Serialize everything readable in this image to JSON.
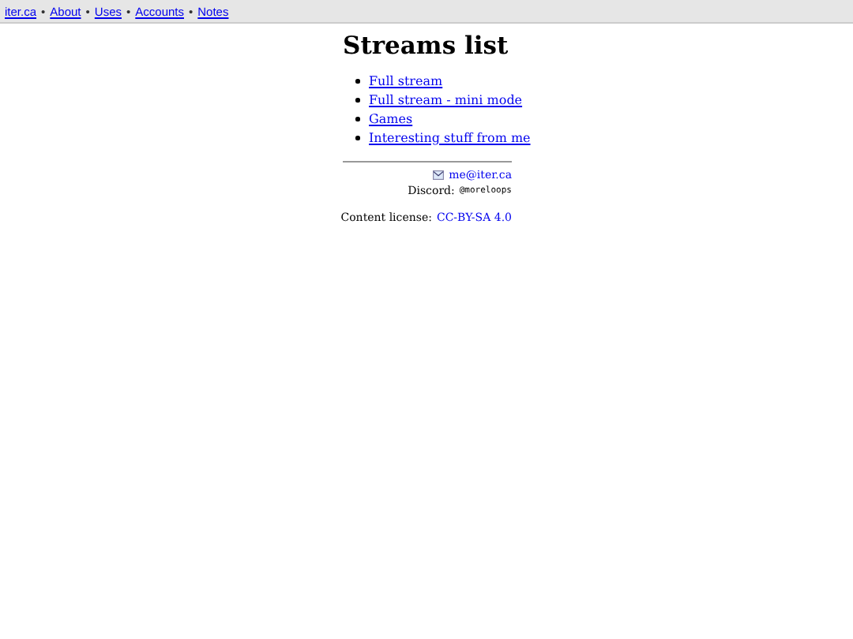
{
  "nav": {
    "links": [
      "iter.ca",
      "About",
      "Uses",
      "Accounts",
      "Notes"
    ],
    "separator": "•"
  },
  "title": "Streams list",
  "streams": [
    "Full stream",
    "Full stream - mini mode",
    "Games",
    "Interesting stuff from me"
  ],
  "footer": {
    "email": "me@iter.ca",
    "discord_label": "Discord:",
    "discord_handle": "@moreloops",
    "license_label": "Content license:",
    "license_link": "CC-BY-SA 4.0"
  }
}
